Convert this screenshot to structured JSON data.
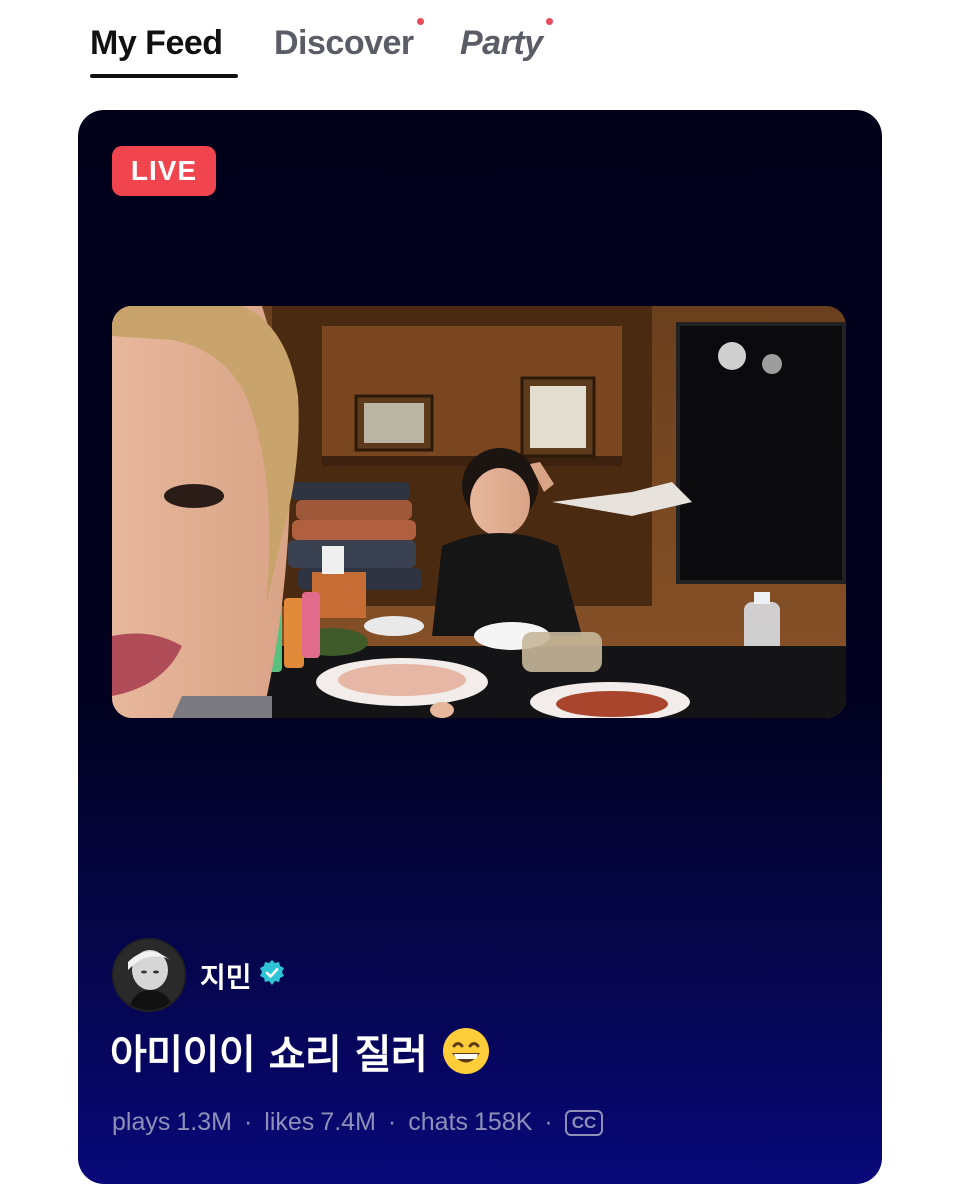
{
  "tabs": [
    {
      "label": "My Feed",
      "active": true,
      "dot": false
    },
    {
      "label": "Discover",
      "active": false,
      "dot": true
    },
    {
      "label": "Party",
      "active": false,
      "dot": true
    }
  ],
  "card": {
    "badge": "LIVE",
    "creator": {
      "name": "지민",
      "verified": true
    },
    "title": "아미이이 쇼리 질러",
    "title_emoji": "grinning-face-icon",
    "stats": {
      "plays_label": "plays",
      "plays_value": "1.3M",
      "likes_label": "likes",
      "likes_value": "7.4M",
      "chats_label": "chats",
      "chats_value": "158K",
      "cc_label": "CC"
    }
  },
  "colors": {
    "live_badge": "#f0444e",
    "tab_dot": "#e84b5a",
    "verified": "#2ec4d6",
    "stats_text": "#8e90b8"
  }
}
